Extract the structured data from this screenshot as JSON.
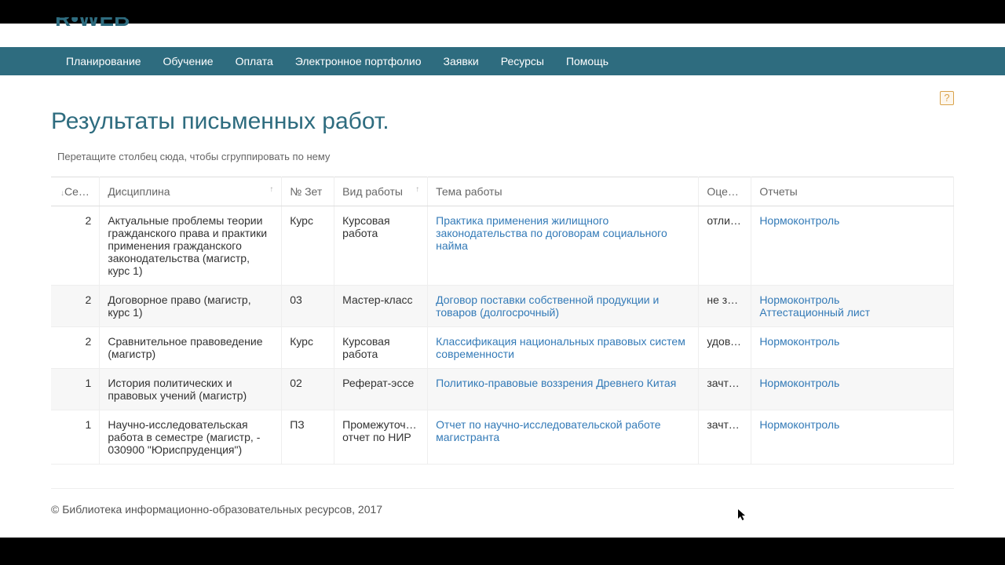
{
  "nav": {
    "items": [
      "Планирование",
      "Обучение",
      "Оплата",
      "Электронное портфолио",
      "Заявки",
      "Ресурсы",
      "Помощь"
    ]
  },
  "help_icon": "?",
  "page_title": "Результаты письменных работ.",
  "group_hint": "Перетащите столбец сюда, чтобы сгруппировать по нему",
  "table": {
    "headers": {
      "semester": "Се…",
      "discipline": "Дисциплина",
      "zet": "№ Зет",
      "work_type": "Вид работы",
      "topic": "Тема работы",
      "grade": "Оценка",
      "reports": "Отчеты"
    },
    "rows": [
      {
        "semester": "2",
        "discipline": "Актуальные проблемы теории гражданского права и практики применения гражданского законодательства (магистр, курс 1)",
        "zet": "Курс",
        "work_type": "Курсовая работа",
        "topic": "Практика применения жилищного законодательства по договорам социального найма",
        "grade": "отлич…",
        "reports": [
          "Нормоконтроль"
        ]
      },
      {
        "semester": "2",
        "discipline": "Договорное право (магистр, курс 1)",
        "zet": "03",
        "work_type": "Мастер-класс",
        "topic": "Договор поставки собственной продукции и товаров (долгосрочный)",
        "grade": "не зачтено",
        "reports": [
          "Нормоконтроль",
          "Аттестационный лист"
        ]
      },
      {
        "semester": "2",
        "discipline": "Сравнительное правоведение (магистр)",
        "zet": "Курс",
        "work_type": "Курсовая работа",
        "topic": "Классификация национальных правовых систем современности",
        "grade": "удовл…",
        "reports": [
          "Нормоконтроль"
        ]
      },
      {
        "semester": "1",
        "discipline": "История политических и правовых учений (магистр)",
        "zet": "02",
        "work_type": "Реферат-эссе",
        "topic": "Политико-правовые воззрения Древнего Китая",
        "grade": "зачтено",
        "reports": [
          "Нормоконтроль"
        ]
      },
      {
        "semester": "1",
        "discipline": "Научно-исследовательская работа в семестре (магистр, - 030900 \"Юриспруденция\")",
        "zet": "ПЗ",
        "work_type": "Промежуточ… отчет по НИР",
        "topic": "Отчет по научно-исследовательской работе магистранта",
        "grade": "зачтено",
        "reports": [
          "Нормоконтроль"
        ]
      }
    ]
  },
  "footer": "© Библиотека информационно-образовательных ресурсов, 2017"
}
